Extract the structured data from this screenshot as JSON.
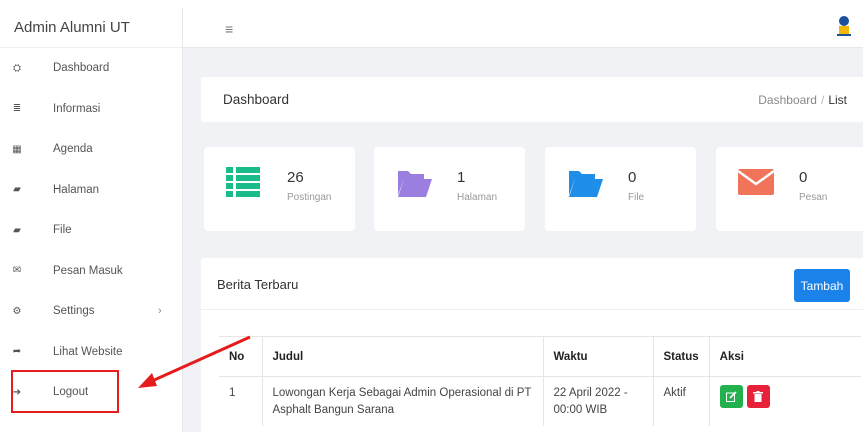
{
  "brand": "Admin Alumni UT",
  "sidebar": {
    "items": [
      {
        "label": "Dashboard",
        "icon": "dashboard-icon",
        "glyph": "⛭"
      },
      {
        "label": "Informasi",
        "icon": "list-icon",
        "glyph": "≣"
      },
      {
        "label": "Agenda",
        "icon": "calendar-icon",
        "glyph": "▦"
      },
      {
        "label": "Halaman",
        "icon": "folder-icon",
        "glyph": "▰"
      },
      {
        "label": "File",
        "icon": "folder-icon",
        "glyph": "▰"
      },
      {
        "label": "Pesan Masuk",
        "icon": "envelope-icon",
        "glyph": "✉"
      },
      {
        "label": "Settings",
        "icon": "gear-icon",
        "glyph": "⚙",
        "chevron": "›"
      },
      {
        "label": "Lihat Website",
        "icon": "share-icon",
        "glyph": "➦"
      },
      {
        "label": "Logout",
        "icon": "sign-out-icon",
        "glyph": "➜"
      }
    ]
  },
  "header": {
    "menu_glyph": "≡"
  },
  "page": {
    "title": "Dashboard",
    "breadcrumb": [
      "Dashboard",
      "List"
    ],
    "separator": "/"
  },
  "stats": [
    {
      "value": "26",
      "caption": "Postingan",
      "icon": "list-icon",
      "color": "#1abc8c"
    },
    {
      "value": "1",
      "caption": "Halaman",
      "icon": "folder-open-icon",
      "color": "#9b7fe0"
    },
    {
      "value": "0",
      "caption": "File",
      "icon": "folder-open-icon",
      "color": "#1f8ee8"
    },
    {
      "value": "0",
      "caption": "Pesan",
      "icon": "envelope-icon",
      "color": "#f0735a"
    }
  ],
  "news": {
    "title": "Berita Terbaru",
    "add_button": "Tambah",
    "columns": [
      "No",
      "Judul",
      "Waktu",
      "Status",
      "Aksi"
    ],
    "rows": [
      {
        "no": "1",
        "judul": "Lowongan Kerja Sebagai Admin Operasional di PT Asphalt Bangun Sarana",
        "waktu": "22 April 2022 - 00:00 WIB",
        "status": "Aktif"
      }
    ]
  },
  "colors": {
    "accent": "#1a82e8",
    "highlight": "#e61c1c",
    "edit": "#22b14c",
    "delete": "#e8213b"
  }
}
